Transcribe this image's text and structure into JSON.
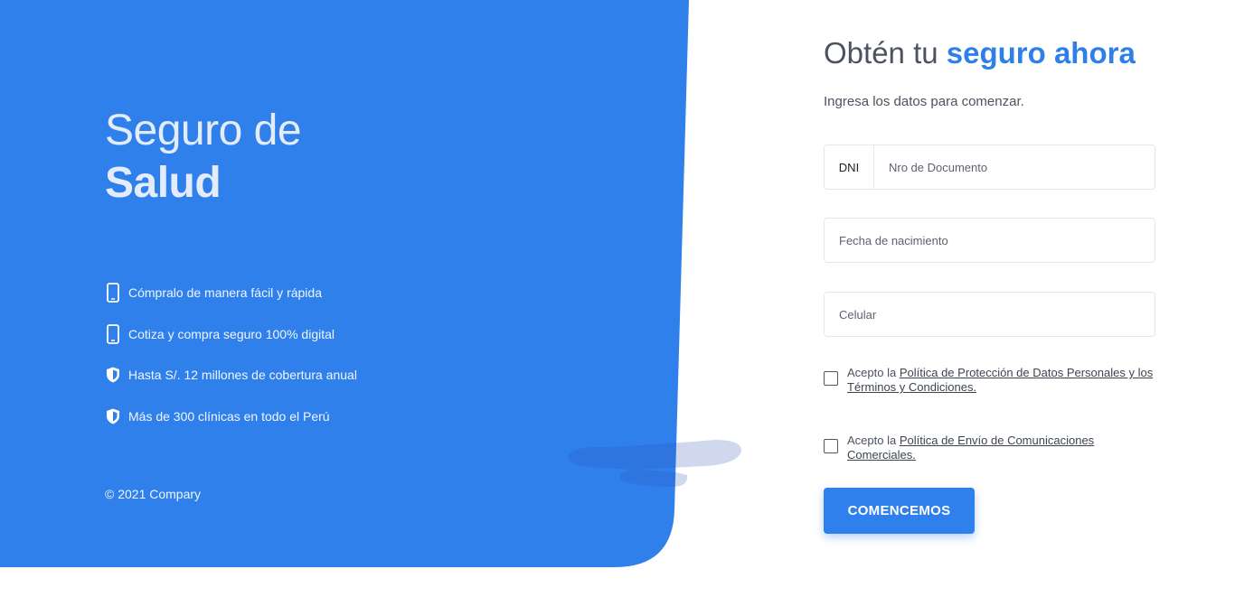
{
  "colors": {
    "brand_blue": "#2f80ed",
    "panel_blue": "#3080ec",
    "text_dark": "#4b5260",
    "title_accent": "#2f7fe9"
  },
  "hero": {
    "title_light": "Seguro de",
    "title_bold": "Salud"
  },
  "features": [
    {
      "icon": "smartphone-icon",
      "text": "Cómpralo de manera fácil y rápida"
    },
    {
      "icon": "smartphone-icon",
      "text": "Cotiza y compra seguro 100% digital"
    },
    {
      "icon": "shield-icon",
      "text": "Hasta S/. 12 millones de cobertura anual"
    },
    {
      "icon": "shield-icon",
      "text": "Más de 300 clínicas en todo el Perú"
    }
  ],
  "footer": {
    "copyright": "© 2021 Compary"
  },
  "form": {
    "title_plain": "Obtén tu ",
    "title_accent": "seguro ahora",
    "subtitle": "Ingresa los datos para comenzar.",
    "document": {
      "prefix": "DNI",
      "placeholder": "Nro de Documento"
    },
    "birthdate": {
      "placeholder": "Fecha de nacimiento"
    },
    "phone": {
      "placeholder": "Celular"
    },
    "consent_privacy": {
      "lead": "Acepto la ",
      "link": "Política de Protección de Datos Personales y los Términos y Condiciones."
    },
    "consent_comms": {
      "lead": "Acepto la ",
      "link": "Política de Envío de Comunicaciones Comerciales."
    },
    "submit_label": "COMENCEMOS"
  }
}
